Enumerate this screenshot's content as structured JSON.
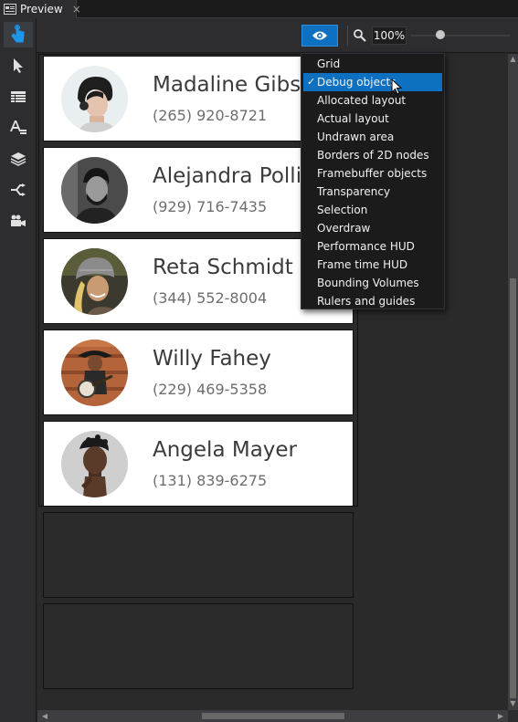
{
  "tab": {
    "title": "Preview",
    "close_glyph": "×"
  },
  "toolbar": {
    "zoom_value": "100%",
    "zoom_slider_level": 0.3,
    "tools": [
      "select-hand-icon",
      "pointer-icon",
      "table-icon",
      "text-style-icon",
      "layers-icon",
      "routing-icon",
      "camera-icon"
    ]
  },
  "contacts": [
    {
      "name": "Madaline Gibson",
      "phone": "(265) 920-8721"
    },
    {
      "name": "Alejandra Pollich",
      "phone": "(929) 716-7435"
    },
    {
      "name": "Reta Schmidt",
      "phone": "(344) 552-8004"
    },
    {
      "name": "Willy Fahey",
      "phone": "(229) 469-5358"
    },
    {
      "name": "Angela Mayer",
      "phone": "(131) 839-6275"
    }
  ],
  "menu": {
    "items": [
      {
        "label": "Grid",
        "checked": false
      },
      {
        "label": "Debug objects",
        "checked": true
      },
      {
        "label": "Allocated layout",
        "checked": false
      },
      {
        "label": "Actual layout",
        "checked": false
      },
      {
        "label": "Undrawn area",
        "checked": false
      },
      {
        "label": "Borders of 2D nodes",
        "checked": false
      },
      {
        "label": "Framebuffer objects",
        "checked": false
      },
      {
        "label": "Transparency",
        "checked": false
      },
      {
        "label": "Selection",
        "checked": false
      },
      {
        "label": "Overdraw",
        "checked": false
      },
      {
        "label": "Performance HUD",
        "checked": false
      },
      {
        "label": "Frame time HUD",
        "checked": false
      },
      {
        "label": "Bounding Volumes",
        "checked": false
      },
      {
        "label": "Rulers and guides",
        "checked": false
      }
    ],
    "check_glyph": "✓"
  },
  "colors": {
    "accent": "#0e70c0",
    "background": "#252526",
    "card": "#ffffff"
  }
}
